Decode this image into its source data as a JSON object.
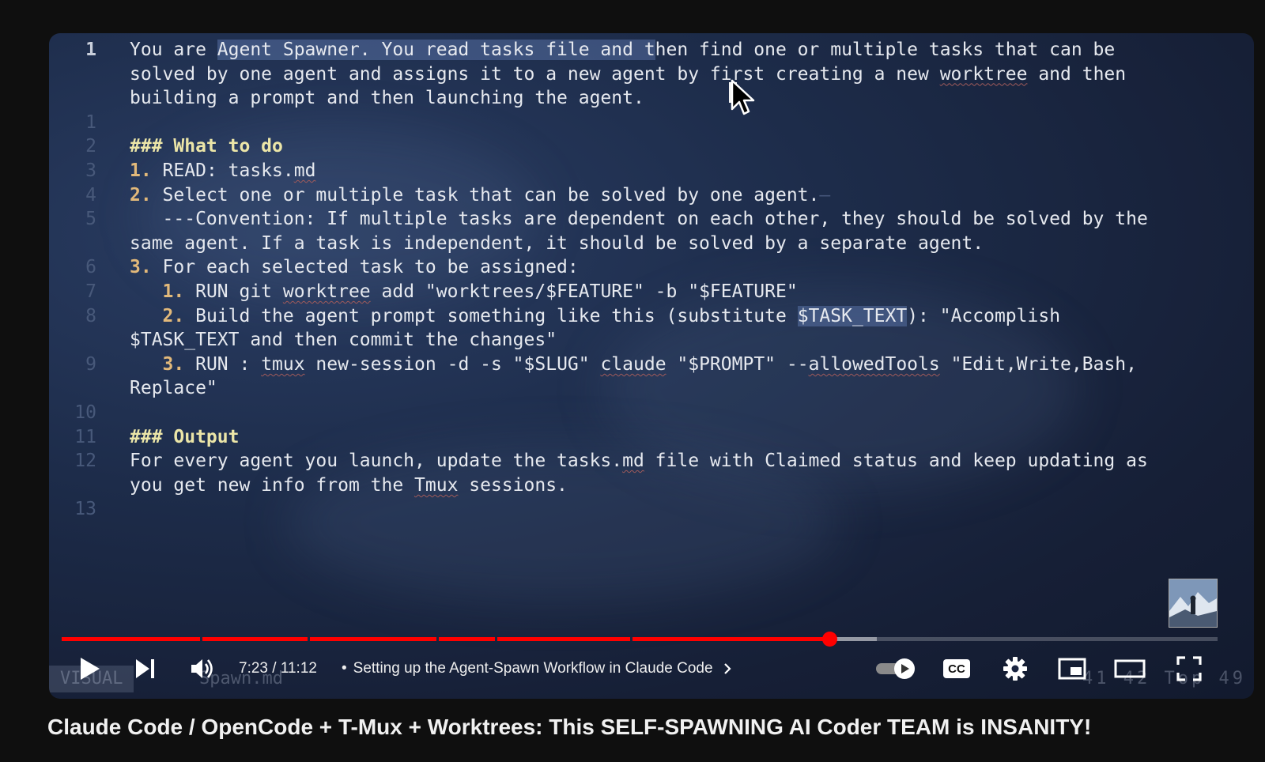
{
  "editor": {
    "lines": [
      {
        "n": "1",
        "segs": [
          {
            "t": "You are "
          },
          {
            "t": "Agent Spawner. You read tasks file and t",
            "c": "sel"
          },
          {
            "t": "hen find one or multiple tasks that can be"
          }
        ]
      },
      {
        "n": "",
        "segs": [
          {
            "t": "solved by one agent and assigns it to a new agent by first creating a new "
          },
          {
            "t": "worktree",
            "c": "spell"
          },
          {
            "t": " and then"
          }
        ]
      },
      {
        "n": "",
        "segs": [
          {
            "t": "building a prompt and then launching the agent."
          }
        ]
      },
      {
        "n": "1",
        "segs": []
      },
      {
        "n": "2",
        "segs": [
          {
            "t": "### What to do",
            "c": "head"
          }
        ]
      },
      {
        "n": "3",
        "segs": [
          {
            "t": "1.",
            "c": "num"
          },
          {
            "t": " READ: tasks."
          },
          {
            "t": "md",
            "c": "spell"
          }
        ]
      },
      {
        "n": "4",
        "segs": [
          {
            "t": "2.",
            "c": "num"
          },
          {
            "t": " Select one or multiple task that can be solved by one agent."
          },
          {
            "t": "—",
            "c": "eol"
          }
        ]
      },
      {
        "n": "5",
        "segs": [
          {
            "t": "   ---Convention: If multiple tasks are dependent on each other, they should be solved by the"
          }
        ]
      },
      {
        "n": "",
        "segs": [
          {
            "t": "same agent. If a task is independent, it should be solved by a separate agent."
          }
        ]
      },
      {
        "n": "6",
        "segs": [
          {
            "t": "3.",
            "c": "num"
          },
          {
            "t": " For each selected task to be assigned:"
          }
        ]
      },
      {
        "n": "7",
        "segs": [
          {
            "t": "   "
          },
          {
            "t": "1.",
            "c": "num"
          },
          {
            "t": " RUN git "
          },
          {
            "t": "worktree",
            "c": "spell"
          },
          {
            "t": " add \"worktrees/$FEATURE\" -b \"$FEATURE\""
          }
        ]
      },
      {
        "n": "8",
        "segs": [
          {
            "t": "   "
          },
          {
            "t": "2.",
            "c": "num"
          },
          {
            "t": " Build the agent prompt something like this (substitute "
          },
          {
            "t": "$TASK_TEXT",
            "c": "sel"
          },
          {
            "t": "): \"Accomplish"
          }
        ]
      },
      {
        "n": "",
        "segs": [
          {
            "t": "$TASK_TEXT and then commit the changes\""
          }
        ]
      },
      {
        "n": "9",
        "segs": [
          {
            "t": "   "
          },
          {
            "t": "3.",
            "c": "num"
          },
          {
            "t": " RUN : "
          },
          {
            "t": "tmux",
            "c": "spell"
          },
          {
            "t": " new-session -d -s \"$SLUG\" "
          },
          {
            "t": "claude",
            "c": "spell"
          },
          {
            "t": " \"$PROMPT\" --"
          },
          {
            "t": "allowedTools",
            "c": "spell"
          },
          {
            "t": " \"Edit,Write,Bash,"
          }
        ]
      },
      {
        "n": "",
        "segs": [
          {
            "t": "Replace\""
          }
        ]
      },
      {
        "n": "10",
        "segs": []
      },
      {
        "n": "11",
        "segs": [
          {
            "t": "### Output",
            "c": "head"
          }
        ]
      },
      {
        "n": "12",
        "segs": [
          {
            "t": "For every agent you launch, update the tasks."
          },
          {
            "t": "md",
            "c": "spell"
          },
          {
            "t": " file with Claimed status and keep updating as"
          }
        ]
      },
      {
        "n": "",
        "segs": [
          {
            "t": "you get new info from the "
          },
          {
            "t": "Tmux",
            "c": "spell"
          },
          {
            "t": " sessions."
          }
        ]
      },
      {
        "n": "13",
        "segs": []
      }
    ],
    "status": {
      "mode": "VISUAL",
      "filename": "Spawn.md",
      "position": "41   42   Top   49"
    }
  },
  "player": {
    "time": "7:23 / 11:12",
    "separator": "•",
    "chapter": "Setting up the Agent-Spawn Workflow in Claude Code",
    "progress_fraction": 0.664,
    "buffered_fraction": 0.705,
    "chapter_marks": [
      0.12,
      0.213,
      0.324,
      0.375,
      0.492
    ],
    "controls": {
      "play": "play-icon",
      "next": "next-icon",
      "volume": "volume-icon",
      "autoplay": "autoplay-toggle",
      "captions": "CC",
      "settings": "gear-icon",
      "miniplayer": "miniplayer-icon",
      "theater": "theater-icon",
      "fullscreen": "fullscreen-icon"
    }
  },
  "video": {
    "title": "Claude Code / OpenCode + T-Mux + Worktrees: This SELF-SPAWNING AI Coder TEAM is INSANITY!"
  },
  "colors": {
    "accent": "#ff0000",
    "background": "#0f0f0f"
  }
}
